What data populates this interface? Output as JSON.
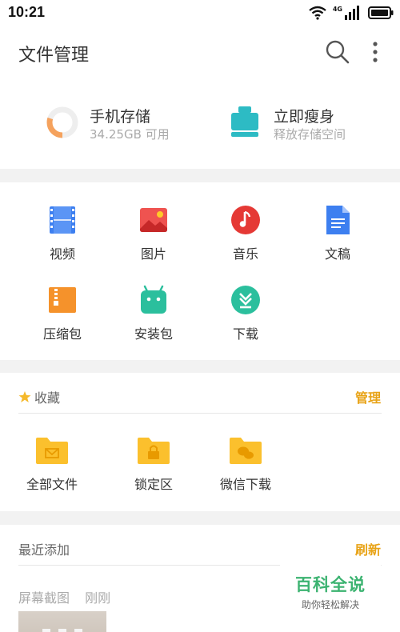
{
  "status": {
    "time": "10:21",
    "network": "4G"
  },
  "header": {
    "title": "文件管理"
  },
  "storage": {
    "phone": {
      "title": "手机存储",
      "available": "34.25GB 可用",
      "used_fraction": 0.3
    },
    "slim": {
      "title": "立即瘦身",
      "subtitle": "释放存储空间"
    }
  },
  "categories": [
    {
      "label": "视频",
      "icon": "video-icon"
    },
    {
      "label": "图片",
      "icon": "image-icon"
    },
    {
      "label": "音乐",
      "icon": "music-icon"
    },
    {
      "label": "文稿",
      "icon": "document-icon"
    },
    {
      "label": "压缩包",
      "icon": "archive-icon"
    },
    {
      "label": "安装包",
      "icon": "android-icon"
    },
    {
      "label": "下载",
      "icon": "download-icon"
    }
  ],
  "favorites": {
    "title": "收藏",
    "action": "管理",
    "items": [
      {
        "label": "全部文件",
        "icon": "folder-mail-icon"
      },
      {
        "label": "锁定区",
        "icon": "folder-lock-icon"
      },
      {
        "label": "微信下载",
        "icon": "folder-wechat-icon"
      }
    ]
  },
  "recent": {
    "title": "最近添加",
    "action": "刷新",
    "item_name": "屏幕截图",
    "item_time": "刚刚"
  },
  "watermark": {
    "main": "百科全说",
    "sub": "助你轻松解决"
  },
  "colors": {
    "accent": "#e8a317",
    "video": "#3d7ff0",
    "image": "#ef5350",
    "music": "#e53935",
    "doc": "#3d7ff0",
    "archive": "#f5922b",
    "android": "#2bbf9d",
    "download": "#2bbf9d",
    "folder": "#fbc02d"
  }
}
